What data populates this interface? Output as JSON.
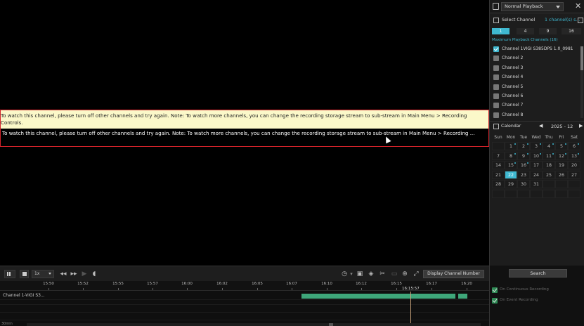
{
  "message": {
    "line1": "To watch this channel, please turn off other channels and try again. Note: To watch more channels, you can change the recording storage stream to sub-stream in Main Menu > Recording Controls.",
    "line2": "To watch this channel, please turn off other channels and try again. Note: To watch more channels, you can change the recording storage stream to sub-stream in Main Menu > Recording ..."
  },
  "panel": {
    "mode": "Normal Playback",
    "select_channel_label": "Select Channel",
    "select_channel_value": "1 channel(s) s...",
    "split_options": [
      "1",
      "4",
      "9",
      "16"
    ],
    "split_active_index": 0,
    "max_channels_label": "Maximum Playback Channels (16)",
    "channels": [
      {
        "label": "Channel 1VIGI S385DPS 1.0_0981",
        "checked": true
      },
      {
        "label": "Channel 2",
        "checked": false
      },
      {
        "label": "Channel 3",
        "checked": false
      },
      {
        "label": "Channel 4",
        "checked": false
      },
      {
        "label": "Channel 5",
        "checked": false
      },
      {
        "label": "Channel 6",
        "checked": false
      },
      {
        "label": "Channel 7",
        "checked": false
      },
      {
        "label": "Channel 8",
        "checked": false
      }
    ],
    "calendar_label": "Calendar",
    "calendar_month": "2025 - 12",
    "weekdays": [
      "Sun",
      "Mon",
      "Tue",
      "Wed",
      "Thu",
      "Fri",
      "Sat"
    ],
    "calendar_days": [
      "",
      "1",
      "2",
      "3",
      "4",
      "5",
      "6",
      "7",
      "8",
      "9",
      "10",
      "11",
      "12",
      "13",
      "14",
      "15",
      "16",
      "17",
      "18",
      "19",
      "20",
      "21",
      "22",
      "23",
      "24",
      "25",
      "26",
      "27",
      "28",
      "29",
      "30",
      "31",
      "",
      "",
      "",
      "",
      "",
      "",
      "",
      "",
      "",
      ""
    ],
    "selected_day": "22",
    "recorded_days": [
      "1",
      "2",
      "3",
      "4",
      "5",
      "6",
      "8",
      "9",
      "10",
      "11",
      "12",
      "13",
      "15",
      "16"
    ],
    "search_label": "Search",
    "legend": [
      {
        "label": "On Continuous Recording"
      },
      {
        "label": "On Event Recording"
      }
    ]
  },
  "toolbar": {
    "speed": "1x",
    "display_channel_number": "Display Channel Number"
  },
  "timeline": {
    "ticks": [
      "15:50",
      "15:52",
      "15:55",
      "15:57",
      "16:00",
      "16:02",
      "16:05",
      "16:07",
      "16:10",
      "16:12",
      "16:15",
      "16:17",
      "16:20"
    ],
    "track_label": "Channel 1-VIGI S3...",
    "cursor_time": "16:15:57",
    "zoom_label": "30min"
  },
  "colors": {
    "accent": "#3fb8d0",
    "alert_border": "#d2232a",
    "message_bg": "#fbf8c9",
    "recording": "#3ea77a"
  }
}
